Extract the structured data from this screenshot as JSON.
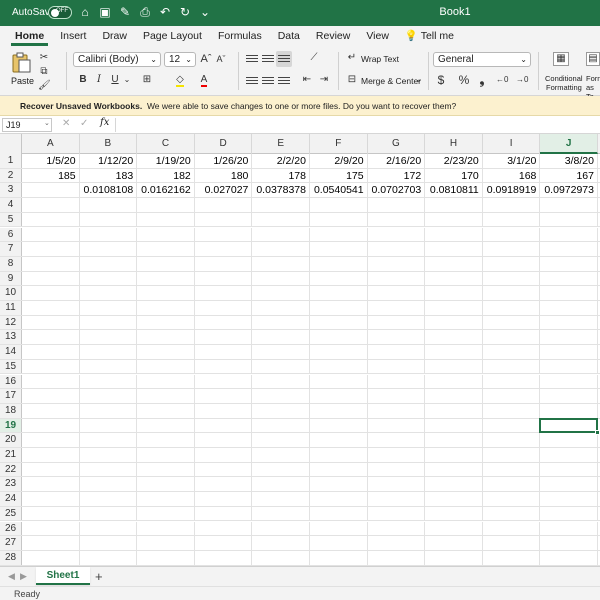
{
  "titlebar": {
    "autosave_label": "AutoSave",
    "autosave_state": "OFF",
    "title": "Book1",
    "icons": [
      "home-icon",
      "save-icon",
      "edit-icon",
      "print-icon",
      "undo-icon",
      "redo-icon",
      "more-icon"
    ]
  },
  "tabs": [
    "Home",
    "Insert",
    "Draw",
    "Page Layout",
    "Formulas",
    "Data",
    "Review",
    "View"
  ],
  "tell_me": "Tell me",
  "ribbon": {
    "paste_label": "Paste",
    "font_name": "Calibri (Body)",
    "font_size": "12",
    "bold": "B",
    "italic": "I",
    "underline": "U",
    "wrap_text": "Wrap Text",
    "merge_center": "Merge & Center",
    "number_format": "General",
    "currency": "$",
    "percent": "%",
    "comma": "❟",
    "conditional_formatting_1": "Conditional",
    "conditional_formatting_2": "Formatting",
    "format_table_1": "Form",
    "format_table_2": "as Ta"
  },
  "infobar": {
    "bold_text": "Recover Unsaved Workbooks.",
    "text": "We were able to save changes to one or more files. Do you want to recover them?"
  },
  "formulabar": {
    "name_box": "J19",
    "fx": "fx",
    "cancel": "✕",
    "confirm": "✓",
    "content": ""
  },
  "grid": {
    "columns": [
      "A",
      "B",
      "C",
      "D",
      "E",
      "F",
      "G",
      "H",
      "I",
      "J"
    ],
    "active_column": "J",
    "active_row": 19,
    "row_count": 28,
    "rows": [
      [
        "1/5/20",
        "1/12/20",
        "1/19/20",
        "1/26/20",
        "2/2/20",
        "2/9/20",
        "2/16/20",
        "2/23/20",
        "3/1/20",
        "3/8/20"
      ],
      [
        "185",
        "183",
        "182",
        "180",
        "178",
        "175",
        "172",
        "170",
        "168",
        "167"
      ],
      [
        "",
        "0.0108108",
        "0.0162162",
        "0.027027",
        "0.0378378",
        "0.0540541",
        "0.0702703",
        "0.0810811",
        "0.0918919",
        "0.0972973"
      ]
    ]
  },
  "sheets": {
    "active": "Sheet1",
    "add": "+"
  },
  "status": "Ready",
  "colors": {
    "accent": "#217346",
    "infobar_bg": "#fcf1cf"
  }
}
